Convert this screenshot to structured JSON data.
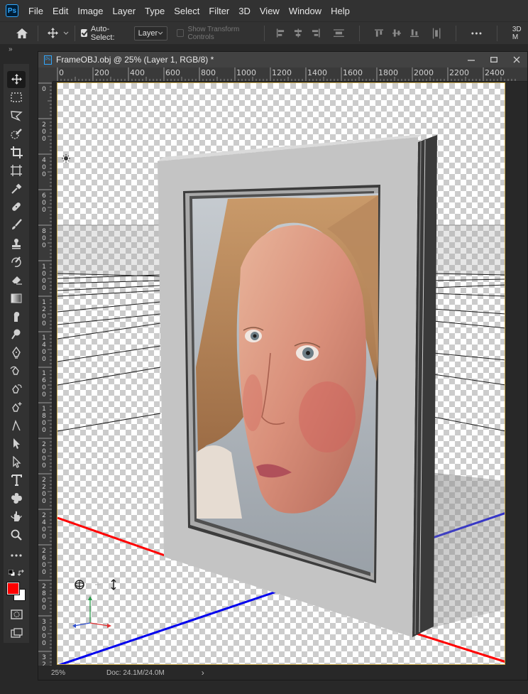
{
  "menubar": {
    "logo": "Ps",
    "items": [
      "File",
      "Edit",
      "Image",
      "Layer",
      "Type",
      "Select",
      "Filter",
      "3D",
      "View",
      "Window",
      "Help"
    ]
  },
  "options": {
    "auto_select_label": "Auto-Select:",
    "auto_select_checked": true,
    "target_value": "Layer",
    "transform_controls_label": "Show Transform Controls",
    "mode_3d_label": "3D M"
  },
  "toolbar": {
    "collapse": "»",
    "tools": [
      "move-tool",
      "marquee-tool",
      "lasso-tool",
      "quick-select-tool",
      "crop-tool",
      "frame-tool",
      "eyedropper-tool",
      "healing-brush-tool",
      "brush-tool",
      "clone-stamp-tool",
      "history-brush-tool",
      "eraser-tool",
      "gradient-tool",
      "smudge-tool",
      "dodge-tool",
      "pen-tool",
      "freeform-pen-tool",
      "curvature-pen-tool",
      "anchor-point-tool",
      "convert-point-tool",
      "path-selection-tool",
      "direct-selection-tool",
      "type-tool",
      "custom-shape-tool",
      "3d-rotate-tool",
      "zoom-tool",
      "more-tools"
    ],
    "foreground_color": "#ff0000",
    "background_color": "#ffffff"
  },
  "document": {
    "title": "FrameOBJ.obj @ 25% (Layer 1, RGB/8) *",
    "ruler_h": [
      "0",
      "200",
      "400",
      "600",
      "800",
      "1000",
      "1200",
      "1400",
      "1600",
      "1800",
      "2000",
      "2200",
      "2400"
    ],
    "ruler_v": [
      "0",
      "200",
      "400",
      "600",
      "800",
      "1000",
      "1200",
      "1400",
      "1600",
      "1800",
      "2000",
      "2200",
      "2400",
      "2600",
      "2800",
      "3000",
      "32"
    ]
  },
  "status": {
    "zoom": "25%",
    "doc": "Doc: 24.1M/24.0M",
    "arrow": "›"
  },
  "colors": {
    "accent": "#31a8ff",
    "x_axis": "#ff0000",
    "z_axis": "#0000ff"
  }
}
